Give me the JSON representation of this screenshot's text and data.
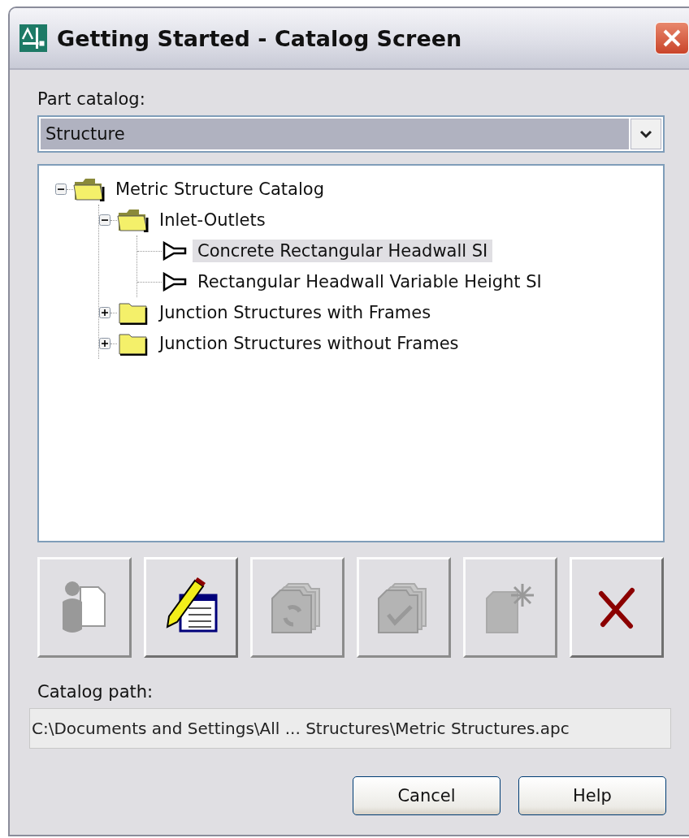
{
  "window": {
    "title": "Getting Started - Catalog Screen"
  },
  "part_catalog": {
    "label": "Part catalog:",
    "value": "Structure"
  },
  "tree": [
    {
      "kind": "folder",
      "label": "Metric Structure Catalog",
      "expanded": true,
      "selected": false,
      "children": [
        {
          "kind": "folder",
          "label": "Inlet-Outlets",
          "expanded": true,
          "selected": false,
          "children": [
            {
              "kind": "part",
              "label": "Concrete Rectangular Headwall SI",
              "selected": true
            },
            {
              "kind": "part",
              "label": "Rectangular Headwall Variable Height SI",
              "selected": false
            }
          ]
        },
        {
          "kind": "folder",
          "label": "Junction Structures with Frames",
          "expanded": false,
          "selected": false
        },
        {
          "kind": "folder",
          "label": "Junction Structures without Frames",
          "expanded": false,
          "selected": false
        }
      ]
    }
  ],
  "toolbar": [
    {
      "kind": "new",
      "disabled": true
    },
    {
      "kind": "edit",
      "disabled": false
    },
    {
      "kind": "regenerate",
      "disabled": true
    },
    {
      "kind": "check",
      "disabled": true
    },
    {
      "kind": "create",
      "disabled": true
    },
    {
      "kind": "delete",
      "disabled": false
    }
  ],
  "catalog_path": {
    "label": "Catalog path:",
    "value": "C:\\Documents and Settings\\All ... Structures\\Metric Structures.apc"
  },
  "buttons": [
    "Cancel",
    "Help"
  ]
}
